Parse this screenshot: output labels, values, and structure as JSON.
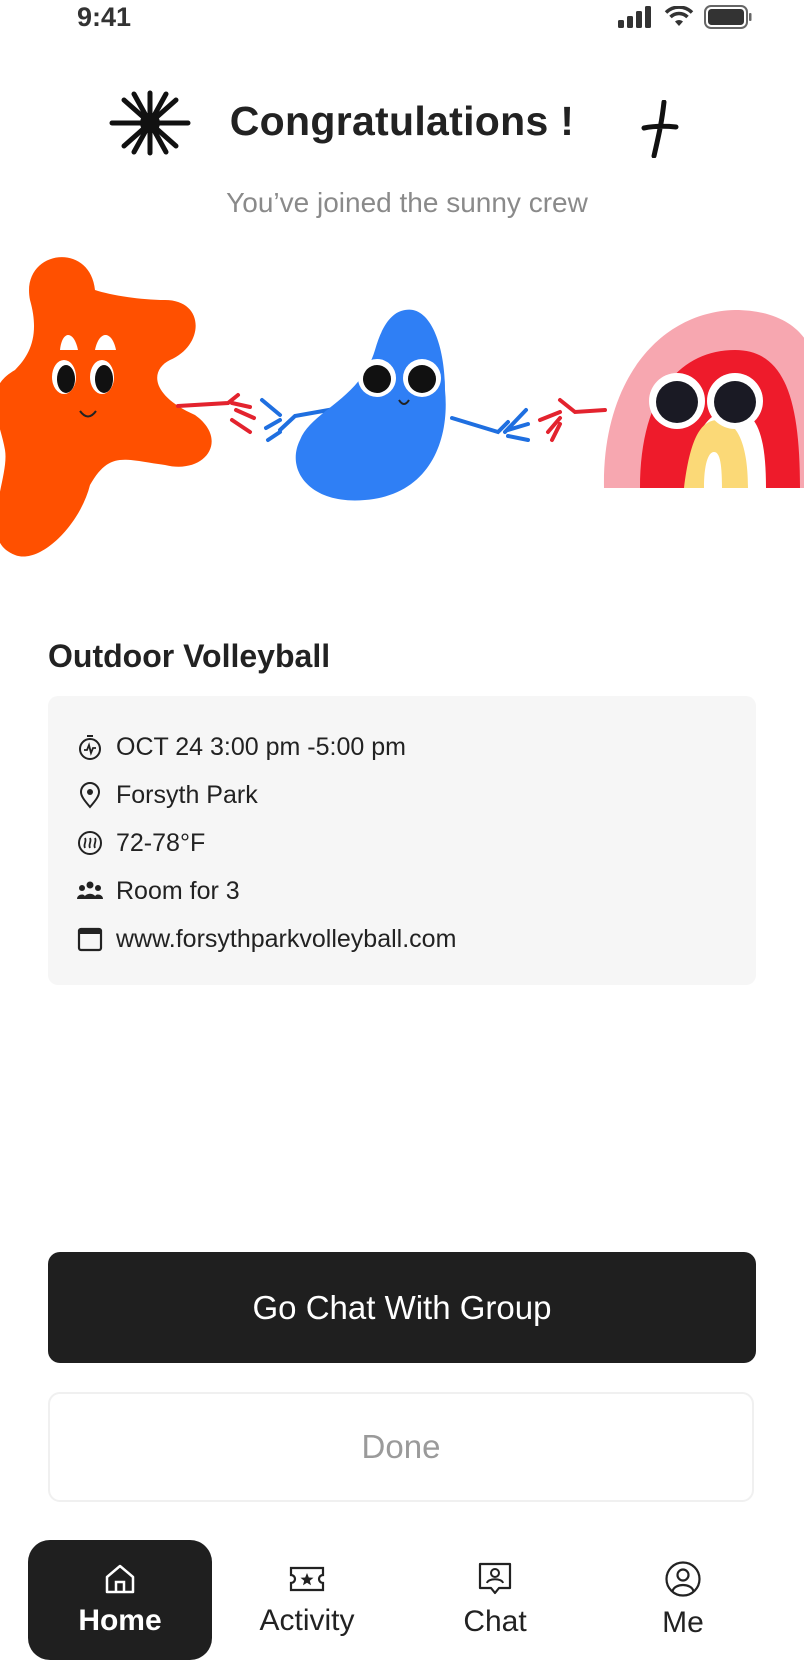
{
  "status_bar": {
    "time": "9:41"
  },
  "header": {
    "title": "Congratulations !",
    "subtitle": "You’ve joined the sunny crew"
  },
  "event": {
    "title": "Outdoor Volleyball",
    "details": [
      {
        "icon": "stopwatch-icon",
        "text": "OCT 24 3:00 pm -5:00 pm"
      },
      {
        "icon": "location-pin-icon",
        "text": "Forsyth Park"
      },
      {
        "icon": "temperature-icon",
        "text": "72-78°F"
      },
      {
        "icon": "people-icon",
        "text": "Room for 3"
      },
      {
        "icon": "browser-window-icon",
        "text": "www.forsythparkvolleyball.com"
      }
    ]
  },
  "actions": {
    "primary_label": "Go Chat With Group",
    "secondary_label": "Done"
  },
  "tabbar": {
    "items": [
      {
        "label": "Home",
        "icon": "home-icon",
        "active": true
      },
      {
        "label": "Activity",
        "icon": "ticket-star-icon",
        "active": false
      },
      {
        "label": "Chat",
        "icon": "chat-user-icon",
        "active": false
      },
      {
        "label": "Me",
        "icon": "user-circle-icon",
        "active": false
      }
    ]
  },
  "colors": {
    "orange_blob": "#ff5000",
    "blue_blob": "#2f7ff5",
    "rainbow_pink": "#f7a7b0",
    "rainbow_red": "#ee1b2b",
    "rainbow_yellow": "#fbd977",
    "dark": "#1f1f1f"
  }
}
